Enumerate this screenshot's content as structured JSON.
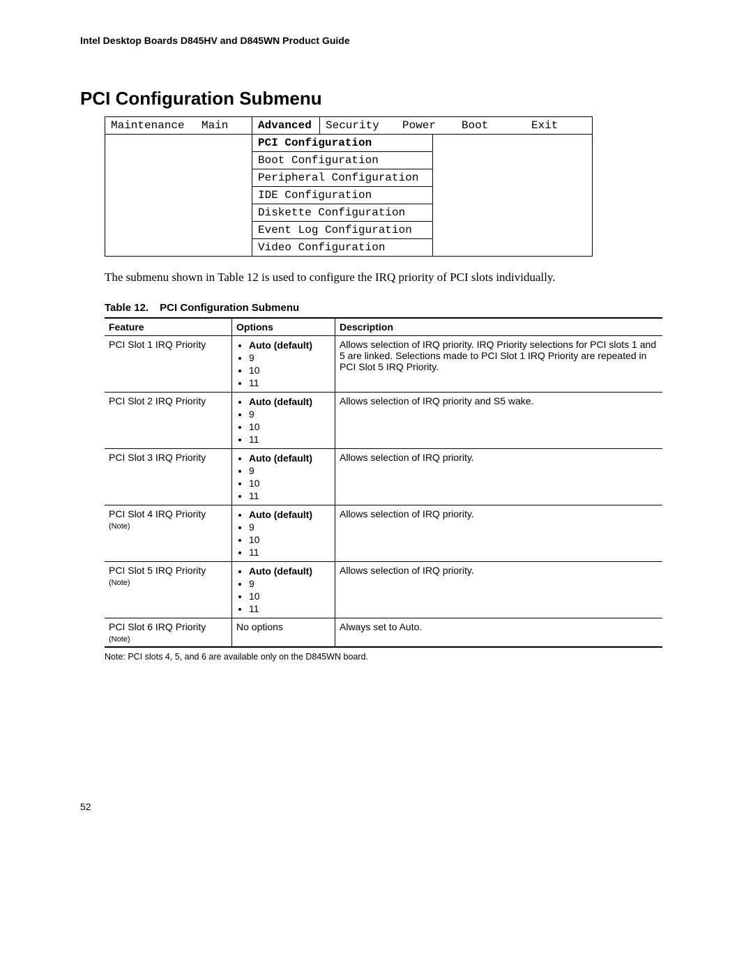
{
  "header": "Intel Desktop Boards D845HV and D845WN Product Guide",
  "title": "PCI Configuration Submenu",
  "bios_tabs": {
    "maint": "Maintenance",
    "main": "Main",
    "advanced": "Advanced",
    "security": "Security",
    "power": "Power",
    "boot": "Boot",
    "exit": "Exit"
  },
  "submenu": {
    "i0": "PCI Configuration",
    "i1": "Boot Configuration",
    "i2": "Peripheral Configuration",
    "i3": "IDE Configuration",
    "i4": "Diskette Configuration",
    "i5": "Event Log Configuration",
    "i6": "Video Configuration"
  },
  "body_text": "The submenu shown in Table 12 is used to configure the IRQ priority of PCI slots individually.",
  "table_caption_num": "Table 12.",
  "table_caption_title": "PCI Configuration Submenu",
  "table_headers": {
    "feature": "Feature",
    "options": "Options",
    "description": "Description"
  },
  "opt": {
    "auto": "Auto (default)",
    "v9": "9",
    "v10": "10",
    "v11": "11",
    "none": "No options"
  },
  "rows": {
    "r1": {
      "feature": "PCI Slot 1 IRQ Priority",
      "desc": "Allows selection of IRQ priority.  IRQ Priority selections for PCI slots 1 and 5 are linked.  Selections made to PCI Slot 1 IRQ Priority are repeated in PCI Slot 5 IRQ Priority."
    },
    "r2": {
      "feature": "PCI Slot 2 IRQ Priority",
      "desc": "Allows selection of IRQ priority and S5 wake."
    },
    "r3": {
      "feature": "PCI Slot 3 IRQ Priority",
      "desc": "Allows selection of IRQ priority."
    },
    "r4": {
      "feature": "PCI Slot 4 IRQ Priority",
      "note": "(Note)",
      "desc": "Allows selection of IRQ priority."
    },
    "r5": {
      "feature": "PCI Slot 5 IRQ Priority",
      "note": "(Note)",
      "desc": "Allows selection of IRQ priority."
    },
    "r6": {
      "feature": "PCI Slot 6 IRQ Priority",
      "note": "(Note)",
      "desc": "Always set to Auto."
    }
  },
  "footnote": "Note:  PCI slots 4, 5, and 6 are available only on the D845WN board.",
  "page_number": "52"
}
